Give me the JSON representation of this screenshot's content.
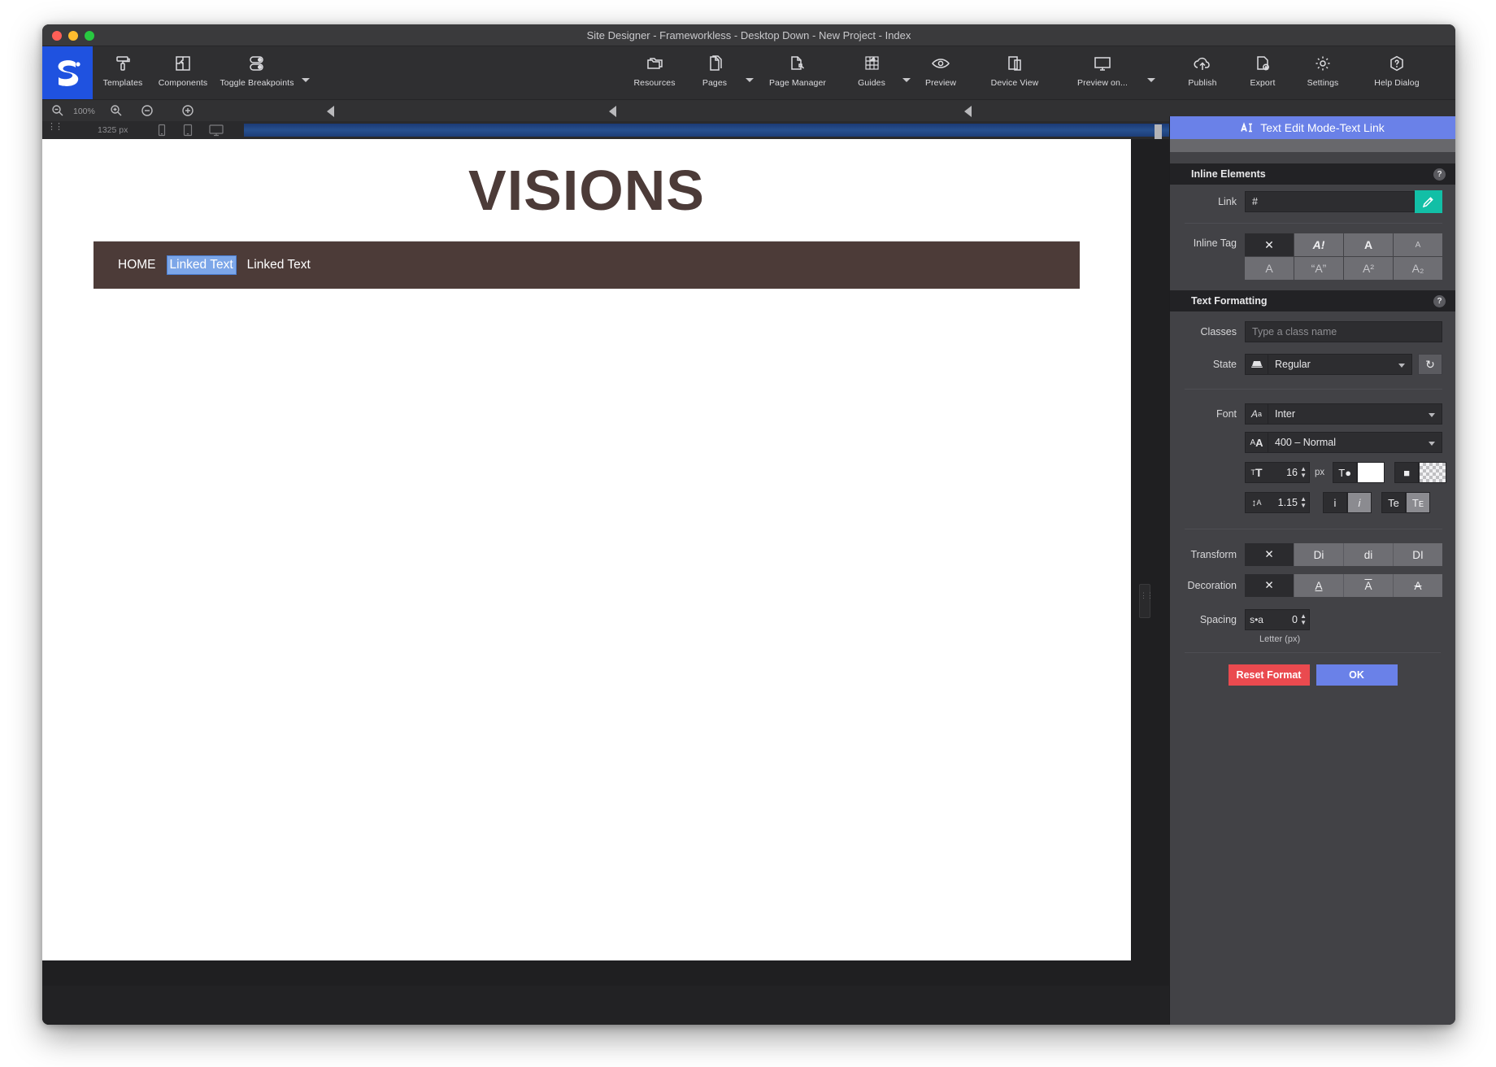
{
  "window": {
    "title": "Site Designer - Frameworkless - Desktop Down - New Project - Index",
    "logo_icon": "site-designer-logo"
  },
  "toolbar": {
    "left_items": [
      {
        "label": "Templates",
        "icon": "paint-roller-icon",
        "caret": false
      },
      {
        "label": "Components",
        "icon": "puzzle-piece-icon",
        "caret": false
      },
      {
        "label": "Toggle Breakpoints",
        "icon": "toggle-switches-icon",
        "caret": true
      }
    ],
    "center_items": [
      {
        "label": "Resources",
        "icon": "folders-icon",
        "caret": false
      },
      {
        "label": "Pages",
        "icon": "pages-icon",
        "caret": true
      },
      {
        "label": "Page Manager",
        "icon": "page-manager-icon",
        "caret": false
      },
      {
        "label": "Guides",
        "icon": "guides-grid-icon",
        "caret": true
      },
      {
        "label": "Preview",
        "icon": "eye-icon",
        "caret": false
      },
      {
        "label": "Device View",
        "icon": "device-view-icon",
        "caret": false
      },
      {
        "label": "Preview on...",
        "icon": "monitor-icon",
        "caret": true
      }
    ],
    "right_items": [
      {
        "label": "Publish",
        "icon": "cloud-upload-icon",
        "caret": false
      },
      {
        "label": "Export",
        "icon": "file-export-icon",
        "caret": false
      },
      {
        "label": "Settings",
        "icon": "gear-icon",
        "caret": false
      },
      {
        "label": "Help Dialog",
        "icon": "question-hexagon-icon",
        "caret": false
      }
    ]
  },
  "zoomstrip": {
    "zoom_out_icon": "magnifier-minus-icon",
    "zoom_level": "100%",
    "zoom_in_icon": "magnifier-plus-icon",
    "minus_icon": "circle-minus-icon",
    "plus_icon": "circle-plus-icon",
    "breakpoint_markers": 3
  },
  "breakpoint_bar": {
    "drag_handle_icon": "drag-dots-icon",
    "width_label": "1325 px",
    "device_icons": [
      "phone-icon",
      "tablet-icon",
      "desktop-icon"
    ]
  },
  "canvas": {
    "hero_title": "VISIONS",
    "nav_links": [
      {
        "label": "HOME",
        "selected": false
      },
      {
        "label": "Linked Text",
        "selected": true
      },
      {
        "label": "Linked Text",
        "selected": false
      }
    ],
    "resize_handle_icon": "canvas-resize-handle-icon",
    "nav_bg_color": "#4c3b38",
    "hero_text_color": "#4c3b38",
    "selection_color": "#7ca6e8"
  },
  "panel": {
    "title": "Text Edit Mode-Text Link",
    "title_icon": "text-cursor-icon",
    "accent_color": "#6a81e8",
    "sections": {
      "inline_elements": {
        "heading": "Inline Elements",
        "help": "?",
        "link_label": "Link",
        "link_value": "#",
        "link_edit_icon": "pencil-icon",
        "link_edit_color": "#12bfa6",
        "inline_tag_label": "Inline Tag",
        "inline_tags": [
          {
            "glyph": "✕",
            "name": "none",
            "active": true
          },
          {
            "glyph": "A!",
            "name": "emphasis",
            "active": false
          },
          {
            "glyph": "A",
            "name": "strong",
            "active": false
          },
          {
            "glyph": "A",
            "name": "small",
            "active": false
          },
          {
            "glyph": "A",
            "name": "underline-tag",
            "active": false
          },
          {
            "glyph": "“A”",
            "name": "quote",
            "active": false
          },
          {
            "glyph": "A²",
            "name": "superscript",
            "active": false
          },
          {
            "glyph": "A₂",
            "name": "subscript",
            "active": false
          }
        ]
      },
      "text_formatting": {
        "heading": "Text Formatting",
        "help": "?",
        "classes_label": "Classes",
        "classes_placeholder": "Type a class name",
        "classes_value": "",
        "state_label": "State",
        "state_icon": "state-device-icon",
        "state_value": "Regular",
        "state_reset_icon": "reset-circular-arrow-icon",
        "font_label": "Font",
        "font_icon": "font-face-icon",
        "font_value": "Inter",
        "weight_icon": "font-weight-icon",
        "weight_value": "400 – Normal",
        "size_icon": "font-size-icon",
        "size_value": "16",
        "size_unit": "px",
        "color_icon": "text-color-icon",
        "color_value": "#ffffff",
        "bg_icon": "text-background-icon",
        "bg_value": "transparent",
        "line_height_icon": "line-height-icon",
        "line_height_value": "1.15",
        "italic_off_glyph": "i",
        "italic_on_glyph": "i",
        "text_case_glyph": "Te",
        "small_caps_glyph": "Tᴇ",
        "transform_label": "Transform",
        "transform_options": [
          {
            "glyph": "✕",
            "name": "none",
            "active": true
          },
          {
            "glyph": "Di",
            "name": "capitalize",
            "active": false
          },
          {
            "glyph": "di",
            "name": "lowercase",
            "active": false
          },
          {
            "glyph": "DI",
            "name": "uppercase",
            "active": false
          }
        ],
        "decoration_label": "Decoration",
        "decoration_options": [
          {
            "glyph": "✕",
            "name": "none",
            "active": true
          },
          {
            "glyph": "A",
            "name": "underline",
            "active": false
          },
          {
            "glyph": "A",
            "name": "overline",
            "active": false
          },
          {
            "glyph": "A",
            "name": "line-through",
            "active": false
          }
        ],
        "spacing_label": "Spacing",
        "spacing_icon": "letter-spacing-icon",
        "spacing_value": "0",
        "spacing_sublabel": "Letter (px)"
      }
    },
    "footer": {
      "reset_label": "Reset Format",
      "reset_color": "#ea4a4f",
      "ok_label": "OK",
      "ok_color": "#6a81e8"
    }
  }
}
